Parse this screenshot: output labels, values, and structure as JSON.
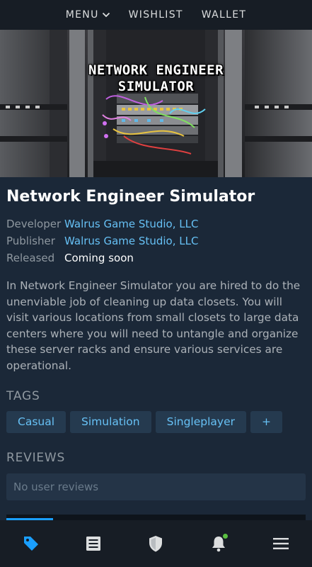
{
  "topnav": {
    "menu_label": "MENU",
    "wishlist_label": "WISHLIST",
    "wallet_label": "WALLET"
  },
  "hero": {
    "title_line1": "NETWORK ENGINEER",
    "title_line2": "SIMULATOR"
  },
  "game": {
    "title": "Network Engineer Simulator",
    "developer_label": "Developer",
    "developer": "Walrus Game Studio, LLC",
    "publisher_label": "Publisher",
    "publisher": "Walrus Game Studio, LLC",
    "released_label": "Released",
    "released": "Coming soon",
    "description": "In Network Engineer Simulator you are hired to do the unenviable job of cleaning up data closets. You will visit various locations from small closets to large data centers where you will need to untangle and organize these server racks and ensure various services are operational."
  },
  "tags": {
    "heading": "TAGS",
    "items": [
      "Casual",
      "Simulation",
      "Singleplayer",
      "+"
    ]
  },
  "reviews": {
    "heading": "REVIEWS",
    "empty_text": "No user reviews"
  },
  "colors": {
    "background": "#1b2838",
    "nav_background": "#171d25",
    "link": "#66c0f4",
    "tag_background": "#253a4f",
    "active_nav": "#1a9fff",
    "notification": "#59bf40"
  },
  "bottomnav": {
    "icons": [
      "store-tag-icon",
      "library-icon",
      "shield-icon",
      "bell-icon",
      "hamburger-menu-icon"
    ],
    "active_index": 0
  }
}
